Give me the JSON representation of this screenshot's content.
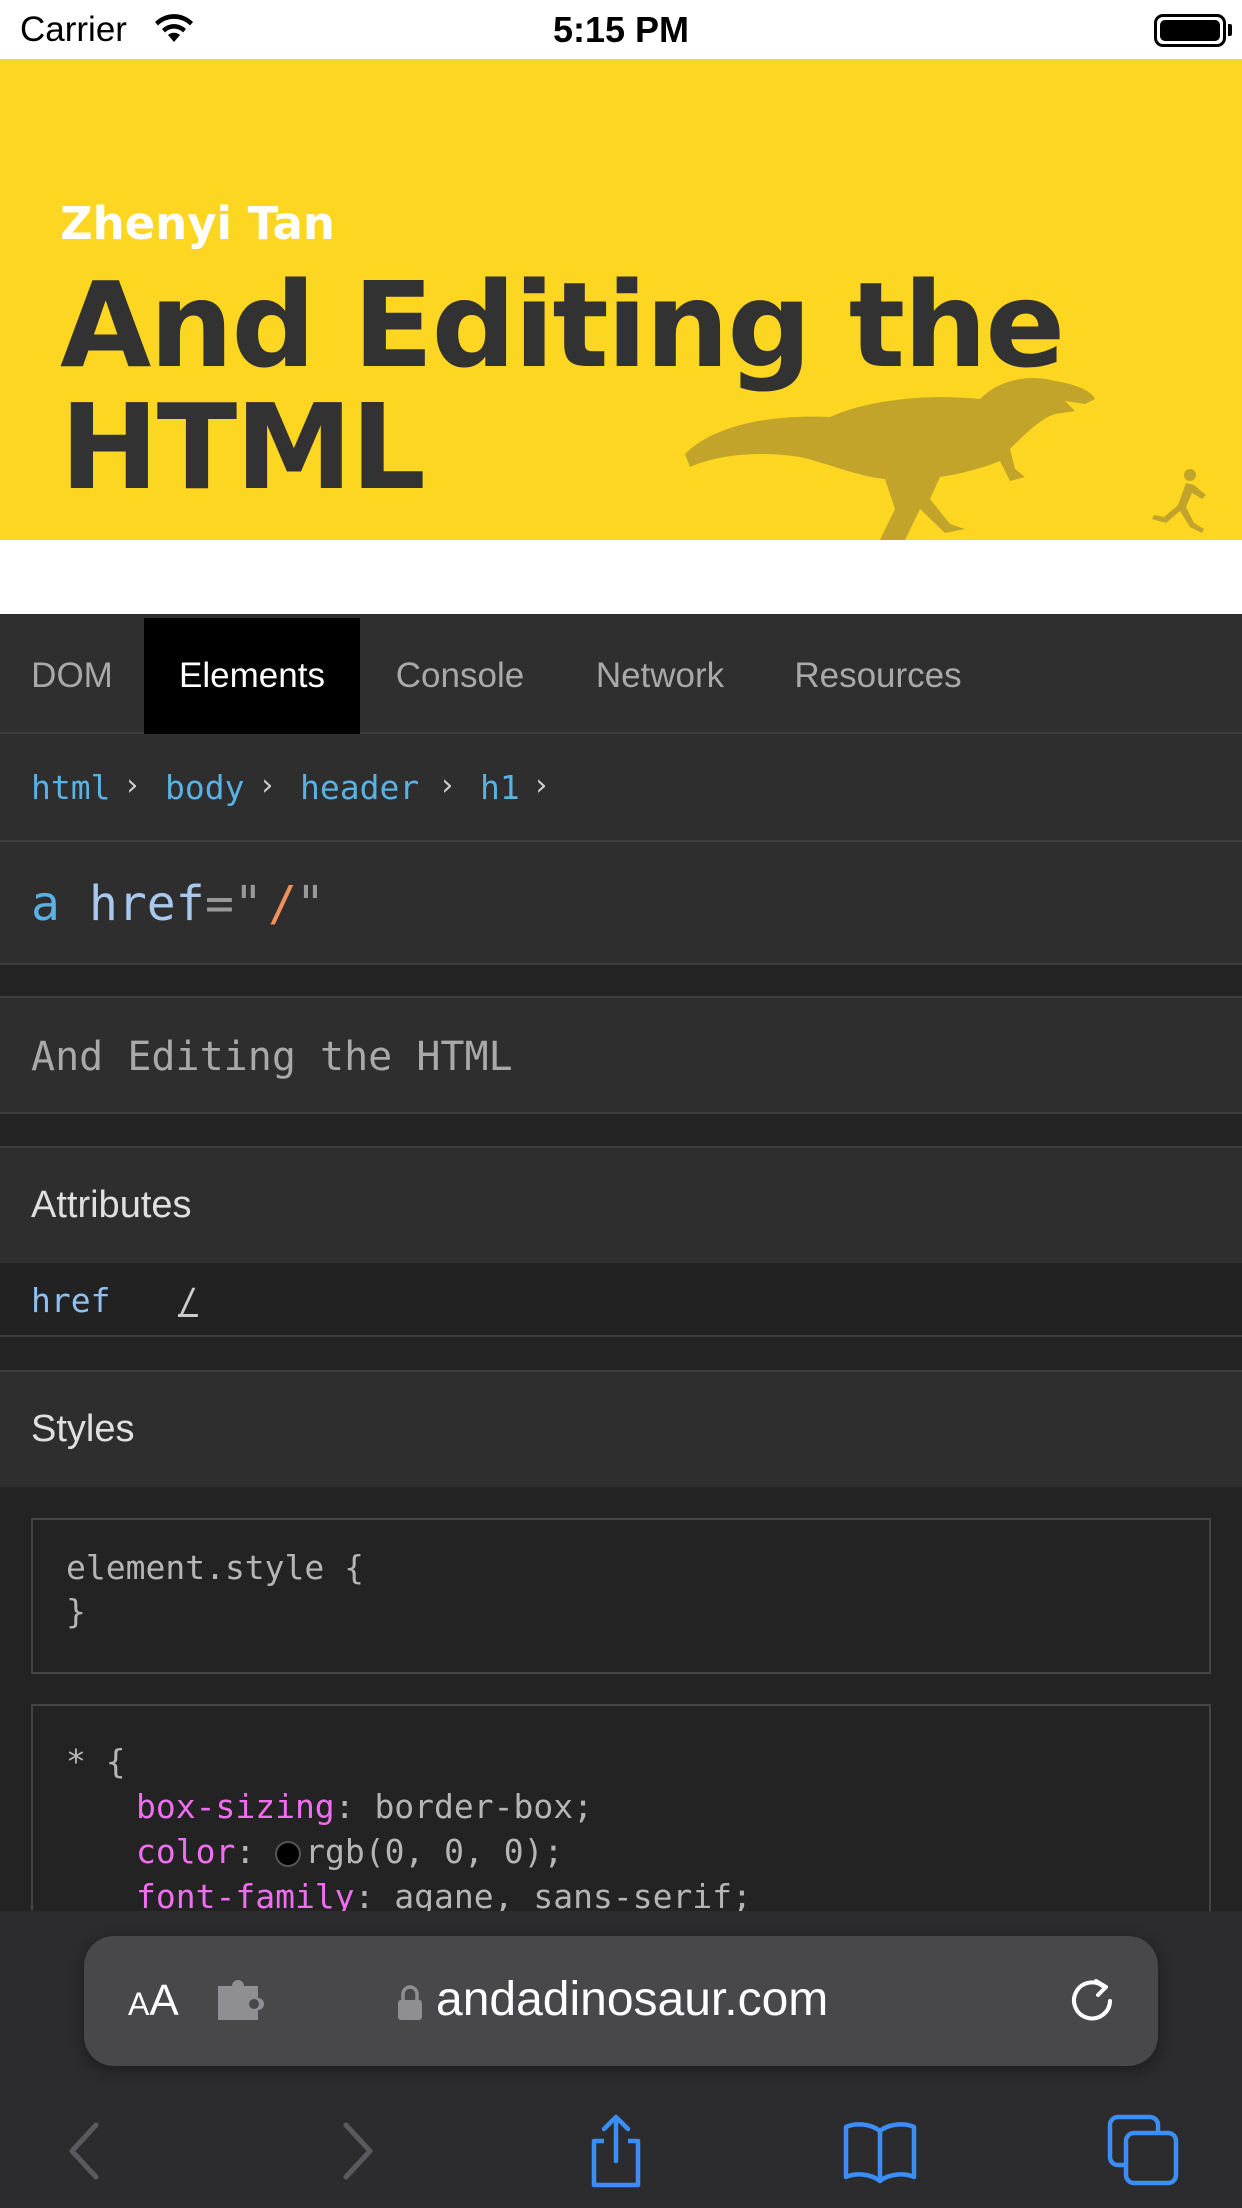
{
  "status_bar": {
    "carrier": "Carrier",
    "time": "5:15 PM"
  },
  "site": {
    "author": "Zhenyi Tan",
    "title": "And Editing the HTML",
    "colors": {
      "background": "#fdd622",
      "title": "#323232",
      "dinosaur": "#c2a42a"
    }
  },
  "devtools": {
    "tabs": [
      {
        "label": "DOM",
        "active": false
      },
      {
        "label": "Elements",
        "active": true
      },
      {
        "label": "Console",
        "active": false
      },
      {
        "label": "Network",
        "active": false
      },
      {
        "label": "Resources",
        "active": false
      }
    ],
    "breadcrumb": [
      "html",
      "body",
      "header",
      "h1"
    ],
    "selected_tag": {
      "name": "a",
      "attr": "href",
      "equals": "=\"",
      "value": "/",
      "close": "\""
    },
    "text_content": "And Editing the HTML",
    "attributes": {
      "title": "Attributes",
      "rows": [
        {
          "name": "href",
          "value": "/"
        }
      ]
    },
    "styles": {
      "title": "Styles",
      "blocks": [
        {
          "selector": "element.style {",
          "close": "}"
        },
        {
          "selector": "* {",
          "declarations": [
            {
              "prop": "box-sizing",
              "value": "border-box;"
            },
            {
              "prop": "color",
              "value": "rgb(0, 0, 0);"
            },
            {
              "prop": "font-family",
              "value": "agane, sans-serif;"
            }
          ]
        }
      ]
    }
  },
  "safari": {
    "aa_label": "AA",
    "url": "andadinosaur.com",
    "toolbar": [
      "back-icon",
      "forward-icon",
      "share-icon",
      "bookmarks-icon",
      "tabs-icon"
    ],
    "colors": {
      "accent": "#3a8ef6",
      "disabled": "#5a5a5e"
    }
  }
}
